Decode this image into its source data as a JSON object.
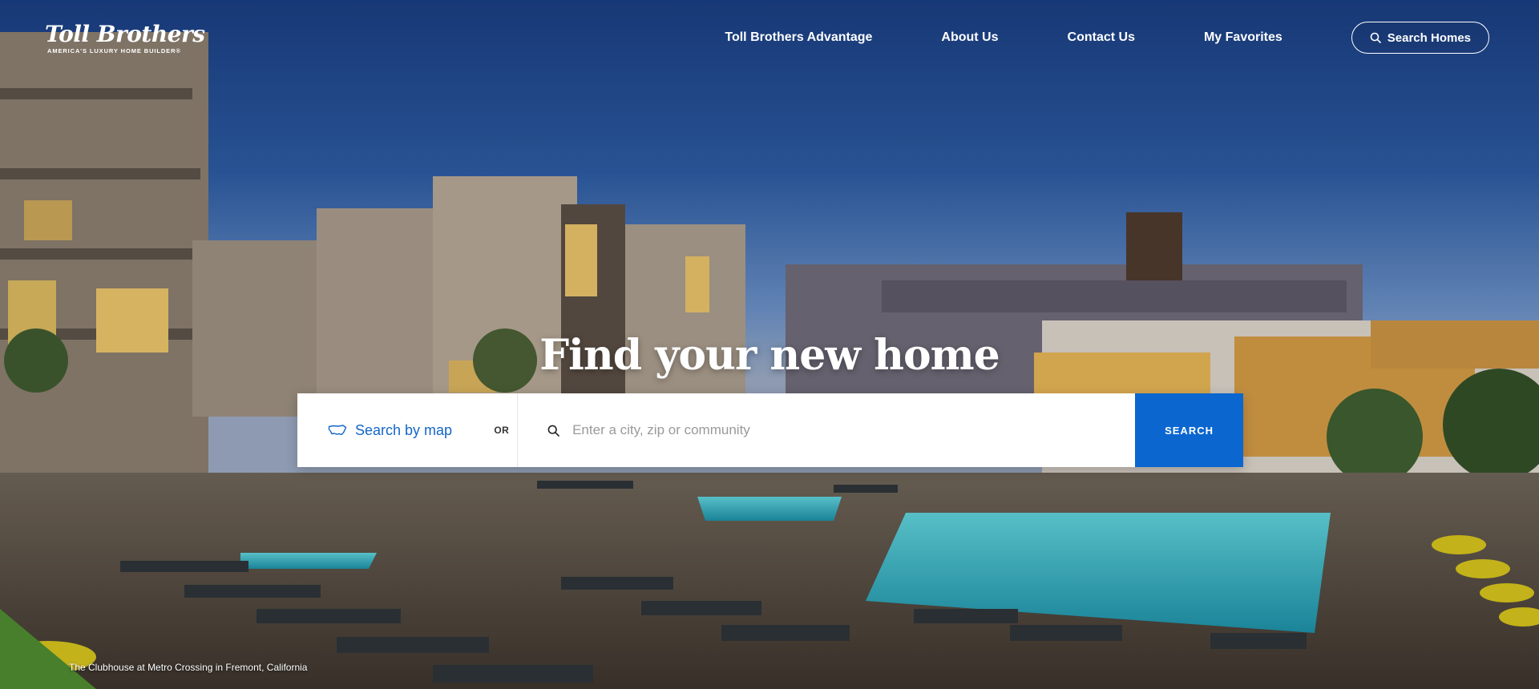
{
  "brand": {
    "name": "Toll Brothers",
    "tagline": "AMERICA'S LUXURY HOME BUILDER®"
  },
  "nav": {
    "items": [
      {
        "label": "Toll Brothers Advantage"
      },
      {
        "label": "About Us"
      },
      {
        "label": "Contact Us"
      },
      {
        "label": "My Favorites"
      }
    ],
    "search_homes_label": "Search Homes"
  },
  "hero": {
    "headline": "Find your new home",
    "caption": "The Clubhouse at Metro Crossing in Fremont, California"
  },
  "search": {
    "map_label": "Search by map",
    "or_label": "OR",
    "placeholder": "Enter a city, zip or community",
    "value": "",
    "button_label": "SEARCH"
  },
  "colors": {
    "accent": "#0b66d0",
    "link": "#1466c8"
  },
  "icons": {
    "map": "us-map-icon",
    "search": "magnifier-icon"
  }
}
